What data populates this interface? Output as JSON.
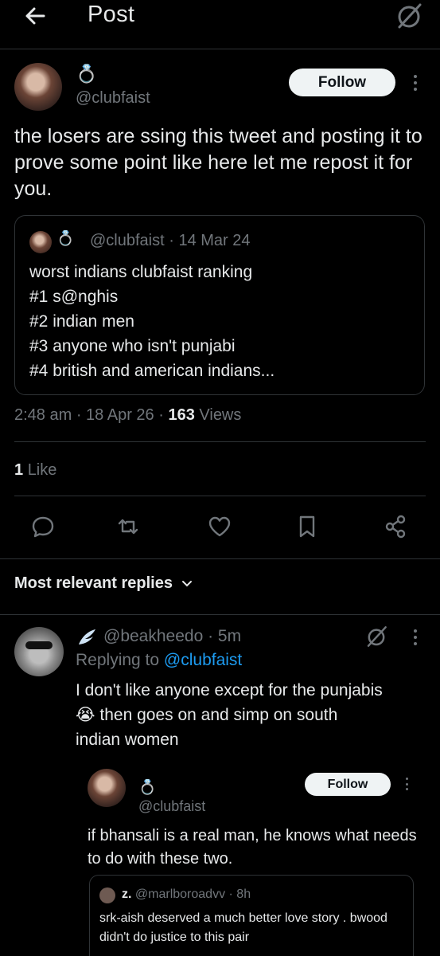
{
  "header": {
    "title": "Post"
  },
  "post": {
    "handle": "@clubfaist",
    "name_emoji": "💍",
    "follow_label": "Follow",
    "text": "the losers are ssing this tweet and posting it to prove some point like here let me repost it for you.",
    "quote": {
      "handle": "@clubfaist",
      "date": "· 14 Mar 24",
      "lines": [
        "worst indians clubfaist ranking",
        "#1 s@nghis",
        "#2 indian men",
        "#3 anyone who isn't punjabi",
        "#4 british and american indians..."
      ]
    },
    "time": "2:48 am",
    "date": "18 Apr 26",
    "views_count": "163",
    "views_label": "Views",
    "likes_count": "1",
    "likes_label": "Like"
  },
  "replies_header": "Most relevant replies",
  "reply": {
    "handle": "@beakheedo",
    "time": "· 5m",
    "replying_to_label": "Replying to",
    "replying_to_handle": "@clubfaist",
    "text_line1": "I don't like anyone except for the punjabis",
    "emoji": "😭",
    "text_line2": "then goes on and simp on south",
    "text_line3": "indian women"
  },
  "nested": {
    "handle": "@clubfaist",
    "follow_label": "Follow",
    "text": "if bhansali is a real man, he knows what needs to do with these two.",
    "quote": {
      "name": "z.",
      "handle": "@marlboroadvv",
      "time": "· 8h",
      "text": "srk-aish deserved a much better love story . bwood didn't do justice to this pair"
    }
  }
}
